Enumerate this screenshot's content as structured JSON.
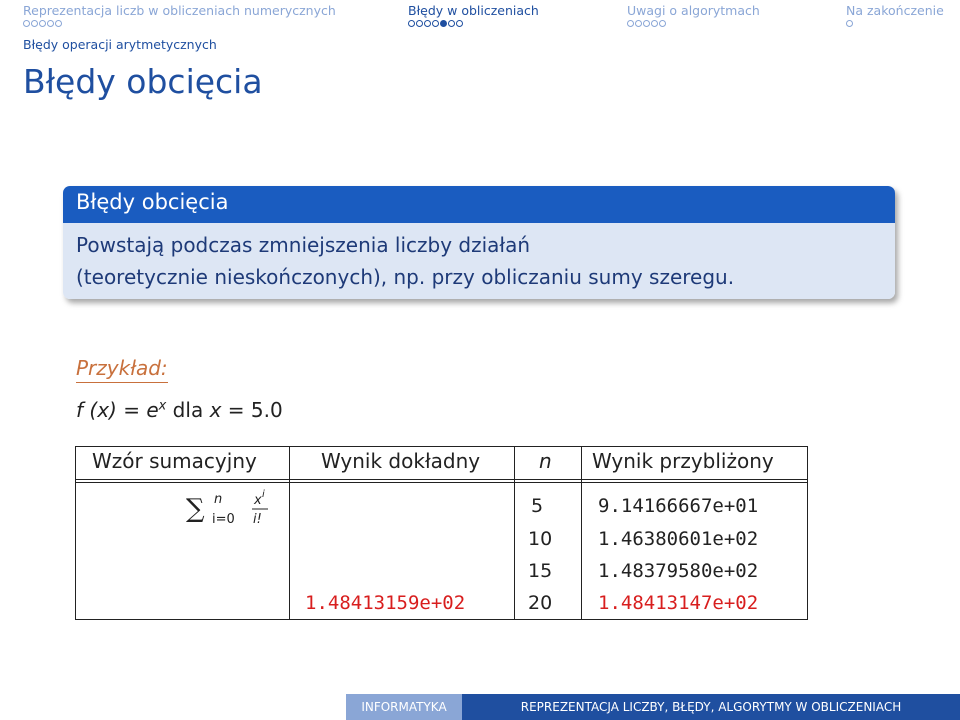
{
  "nav": {
    "sections": [
      {
        "label": "Reprezentacja liczb w obliczeniach numerycznych",
        "dots": 5,
        "filled": -1,
        "active": false
      },
      {
        "label": "Błędy w obliczeniach",
        "dots": 7,
        "filled": 4,
        "active": true
      },
      {
        "label": "Uwagi o algorytmach",
        "dots": 5,
        "filled": -1,
        "active": false
      },
      {
        "label": "Na zakończenie",
        "dots": 1,
        "filled": -1,
        "active": false
      }
    ],
    "subsection": "Błędy operacji arytmetycznych"
  },
  "frame_title": "Błędy obcięcia",
  "block": {
    "title": "Błędy obcięcia",
    "line1": "Powstają podczas zmniejszenia liczby działań",
    "line2": "(teoretycznie nieskończonych), np. przy obliczaniu sumy szeregu."
  },
  "example": {
    "title": "Przykład:",
    "fx": "f (x) = e",
    "exp": "x",
    "rest_a": " dla ",
    "x": "x",
    "rest_b": " = 5.0"
  },
  "table": {
    "headers": [
      "Wzór sumacyjny",
      "Wynik dokładny",
      "n",
      "Wynik przybliżony"
    ],
    "sum_formula": {
      "upper": "n",
      "lower": "i=0",
      "num": "x",
      "num_exp": "i",
      "den": "i!"
    },
    "exact": "1.48413159e+02",
    "rows": [
      {
        "n": "5",
        "approx": "9.14166667e+01"
      },
      {
        "n": "10",
        "approx": "1.46380601e+02"
      },
      {
        "n": "15",
        "approx": "1.48379580e+02"
      },
      {
        "n": "20",
        "approx": "1.48413147e+02"
      }
    ]
  },
  "footer": {
    "left": "INFORMATYKA",
    "right": "REPREZENTACJA LICZBY, BŁĘDY, ALGORYTMY W OBLICZENIACH"
  },
  "colors": {
    "accent": "#1f4fa0",
    "block_head": "#1a5cc0",
    "block_body": "#dde6f4",
    "example": "#c8703c",
    "highlight_red": "#d81e1e"
  }
}
